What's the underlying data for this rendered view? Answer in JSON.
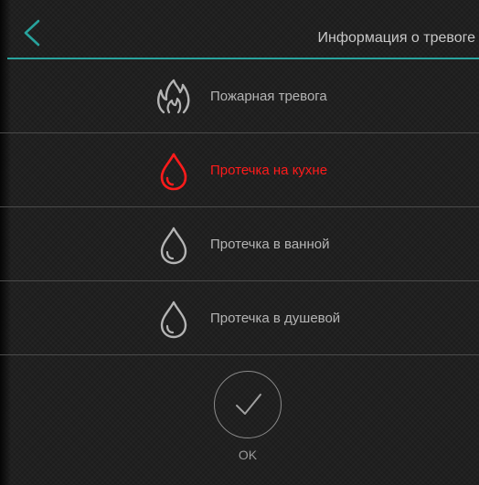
{
  "header": {
    "title": "Информация о тревоге",
    "back_icon": "chevron-left-icon",
    "accent_color": "#28a39d"
  },
  "alarms": [
    {
      "label": "Пожарная тревога",
      "icon": "fire-icon",
      "active": false,
      "color": "#b4b4b4"
    },
    {
      "label": "Протечка на кухне",
      "icon": "water-drop-icon",
      "active": true,
      "color": "#ff1b1b"
    },
    {
      "label": "Протечка в ванной",
      "icon": "water-drop-icon",
      "active": false,
      "color": "#b4b4b4"
    },
    {
      "label": "Протечка в душевой",
      "icon": "water-drop-icon",
      "active": false,
      "color": "#b4b4b4"
    }
  ],
  "ok_button": {
    "label": "OK",
    "icon": "checkmark-icon"
  }
}
